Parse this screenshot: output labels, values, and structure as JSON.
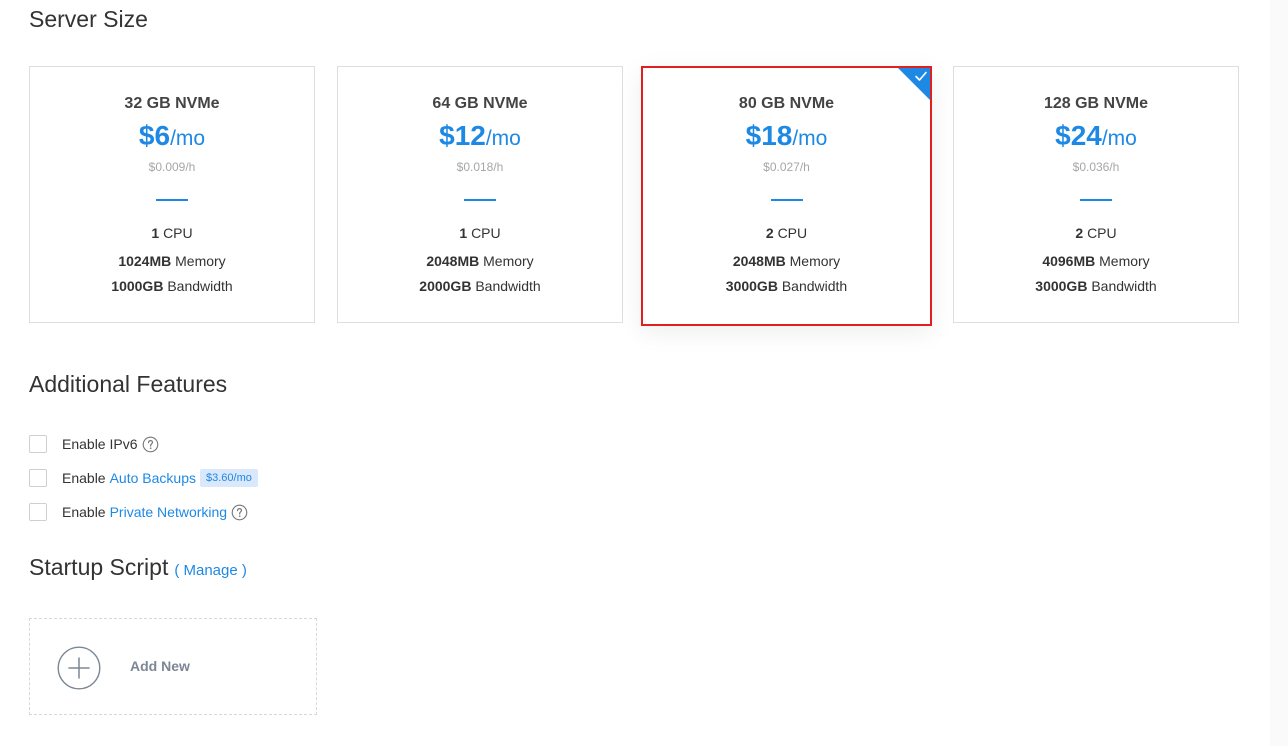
{
  "sections": {
    "server_size": "Server Size",
    "additional_features": "Additional Features",
    "startup_script": "Startup Script",
    "manage_link": "( Manage )"
  },
  "plans": [
    {
      "name": "32 GB NVMe",
      "price": "$6",
      "per": "/mo",
      "hourly": "$0.009/h",
      "cpu_count": "1",
      "cpu_label": "CPU",
      "memory": "1024MB",
      "memory_label": "Memory",
      "bandwidth": "1000GB",
      "bandwidth_label": "Bandwidth",
      "selected": false
    },
    {
      "name": "64 GB NVMe",
      "price": "$12",
      "per": "/mo",
      "hourly": "$0.018/h",
      "cpu_count": "1",
      "cpu_label": "CPU",
      "memory": "2048MB",
      "memory_label": "Memory",
      "bandwidth": "2000GB",
      "bandwidth_label": "Bandwidth",
      "selected": false
    },
    {
      "name": "80 GB NVMe",
      "price": "$18",
      "per": "/mo",
      "hourly": "$0.027/h",
      "cpu_count": "2",
      "cpu_label": "CPU",
      "memory": "2048MB",
      "memory_label": "Memory",
      "bandwidth": "3000GB",
      "bandwidth_label": "Bandwidth",
      "selected": true
    },
    {
      "name": "128 GB NVMe",
      "price": "$24",
      "per": "/mo",
      "hourly": "$0.036/h",
      "cpu_count": "2",
      "cpu_label": "CPU",
      "memory": "4096MB",
      "memory_label": "Memory",
      "bandwidth": "3000GB",
      "bandwidth_label": "Bandwidth",
      "selected": false
    }
  ],
  "features": {
    "ipv6": {
      "prefix": "Enable IPv6",
      "checked": false,
      "icon": "help-circle-icon"
    },
    "backups": {
      "prefix": "Enable",
      "link": "Auto Backups",
      "price": "$3.60/mo",
      "checked": false
    },
    "private_networking": {
      "prefix": "Enable",
      "link": "Private Networking",
      "checked": false,
      "icon": "help-circle-icon"
    }
  },
  "startup": {
    "add_label": "Add New",
    "icon": "plus-circle-icon"
  },
  "colors": {
    "accent": "#1e88e5",
    "selected_border": "#e01f1f",
    "muted": "#a6a6a6",
    "tag_bg": "#d9e8fb"
  }
}
